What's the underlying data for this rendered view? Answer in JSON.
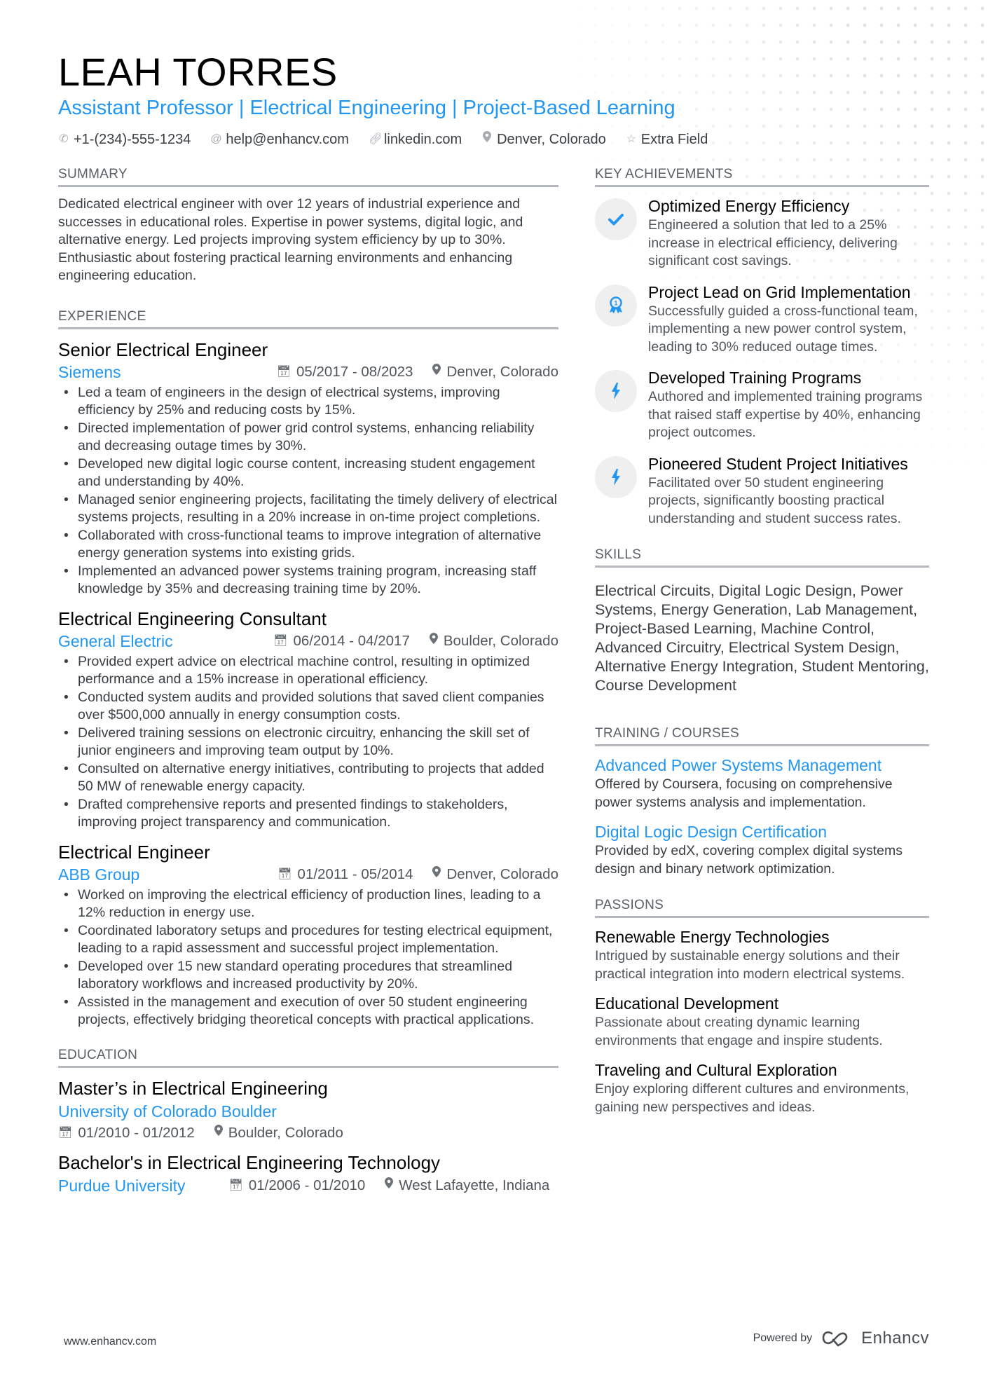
{
  "header": {
    "name": "LEAH TORRES",
    "subtitle": "Assistant Professor | Electrical Engineering | Project-Based Learning",
    "contacts": [
      {
        "icon": "phone-icon",
        "text": "+1-(234)-555-1234"
      },
      {
        "icon": "at-icon",
        "text": "help@enhancv.com"
      },
      {
        "icon": "link-icon",
        "text": "linkedin.com"
      },
      {
        "icon": "location-pin-icon",
        "text": "Denver, Colorado"
      },
      {
        "icon": "star-icon",
        "text": "Extra Field"
      }
    ]
  },
  "summary": {
    "title": "SUMMARY",
    "text": "Dedicated electrical engineer with over 12 years of industrial experience and successes in educational roles. Expertise in power systems, digital logic, and alternative energy. Led projects improving system efficiency by up to 30%. Enthusiastic about fostering practical learning environments and enhancing engineering education."
  },
  "experience": {
    "title": "EXPERIENCE",
    "jobs": [
      {
        "title": "Senior Electrical Engineer",
        "company": "Siemens",
        "dates": "05/2017 - 08/2023",
        "location": "Denver, Colorado",
        "bullets": [
          "Led a team of engineers in the design of electrical systems, improving efficiency by 25% and reducing costs by 15%.",
          "Directed implementation of power grid control systems, enhancing reliability and decreasing outage times by 30%.",
          "Developed new digital logic course content, increasing student engagement and understanding by 40%.",
          "Managed senior engineering projects, facilitating the timely delivery of electrical systems projects, resulting in a 20% increase in on-time project completions.",
          "Collaborated with cross-functional teams to improve integration of alternative energy generation systems into existing grids.",
          "Implemented an advanced power systems training program, increasing staff knowledge by 35% and decreasing training time by 20%."
        ]
      },
      {
        "title": "Electrical Engineering Consultant",
        "company": "General Electric",
        "dates": "06/2014 - 04/2017",
        "location": "Boulder, Colorado",
        "bullets": [
          "Provided expert advice on electrical machine control, resulting in optimized performance and a 15% increase in operational efficiency.",
          "Conducted system audits and provided solutions that saved client companies over $500,000 annually in energy consumption costs.",
          "Delivered training sessions on electronic circuitry, enhancing the skill set of junior engineers and improving team output by 10%.",
          "Consulted on alternative energy initiatives, contributing to projects that added 50 MW of renewable energy capacity.",
          "Drafted comprehensive reports and presented findings to stakeholders, improving project transparency and communication."
        ]
      },
      {
        "title": "Electrical Engineer",
        "company": "ABB Group",
        "dates": "01/2011 - 05/2014",
        "location": "Denver, Colorado",
        "bullets": [
          "Worked on improving the electrical efficiency of production lines, leading to a 12% reduction in energy use.",
          "Coordinated laboratory setups and procedures for testing electrical equipment, leading to a rapid assessment and successful project implementation.",
          "Developed over 15 new standard operating procedures that streamlined laboratory workflows and increased productivity by 20%.",
          "Assisted in the management and execution of over 50 student engineering projects, effectively bridging theoretical concepts with practical applications."
        ]
      }
    ]
  },
  "education": {
    "title": "EDUCATION",
    "items": [
      {
        "degree": "Master’s in Electrical Engineering",
        "school": "University of Colorado Boulder",
        "dates": "01/2010 - 01/2012",
        "location": "Boulder, Colorado"
      },
      {
        "degree": "Bachelor's in Electrical Engineering Technology",
        "school": "Purdue University",
        "dates": "01/2006 - 01/2010",
        "location": "West Lafayette, Indiana"
      }
    ]
  },
  "achievements": {
    "title": "KEY ACHIEVEMENTS",
    "items": [
      {
        "icon": "checkmark-icon",
        "title": "Optimized Energy Efficiency",
        "desc": "Engineered a solution that led to a 25% increase in electrical efficiency, delivering significant cost savings."
      },
      {
        "icon": "award-ribbon-icon",
        "title": "Project Lead on Grid Implementation",
        "desc": "Successfully guided a cross-functional team, implementing a new power control system, leading to 30% reduced outage times."
      },
      {
        "icon": "lightning-bolt-icon",
        "title": "Developed Training Programs",
        "desc": "Authored and implemented training programs that raised staff expertise by 40%, enhancing project outcomes."
      },
      {
        "icon": "lightning-bolt-icon",
        "title": "Pioneered Student Project Initiatives",
        "desc": "Facilitated over 50 student engineering projects, significantly boosting practical understanding and student success rates."
      }
    ]
  },
  "skills": {
    "title": "SKILLS",
    "text": "Electrical Circuits, Digital Logic Design, Power Systems, Energy Generation, Lab Management, Project-Based Learning, Machine Control, Advanced Circuitry, Electrical System Design, Alternative Energy Integration, Student Mentoring, Course Development"
  },
  "training": {
    "title": "TRAINING / COURSES",
    "items": [
      {
        "title": "Advanced Power Systems Management",
        "desc": "Offered by Coursera, focusing on comprehensive power systems analysis and implementation."
      },
      {
        "title": "Digital Logic Design Certification",
        "desc": "Provided by edX, covering complex digital systems design and binary network optimization."
      }
    ]
  },
  "passions": {
    "title": "PASSIONS",
    "items": [
      {
        "title": "Renewable Energy Technologies",
        "desc": "Intrigued by sustainable energy solutions and their practical integration into modern electrical systems."
      },
      {
        "title": "Educational Development",
        "desc": "Passionate about creating dynamic learning environments that engage and inspire students."
      },
      {
        "title": "Traveling and Cultural Exploration",
        "desc": "Enjoy exploring different cultures and environments, gaining new perspectives and ideas."
      }
    ]
  },
  "footer": {
    "website": "www.enhancv.com",
    "powered_by": "Powered by",
    "brand": "Enhancv"
  },
  "colors": {
    "accent": "#2196f3",
    "text": "#3a3f44",
    "rule": "#b4b8bd",
    "icon_circle": "#efeff0"
  }
}
